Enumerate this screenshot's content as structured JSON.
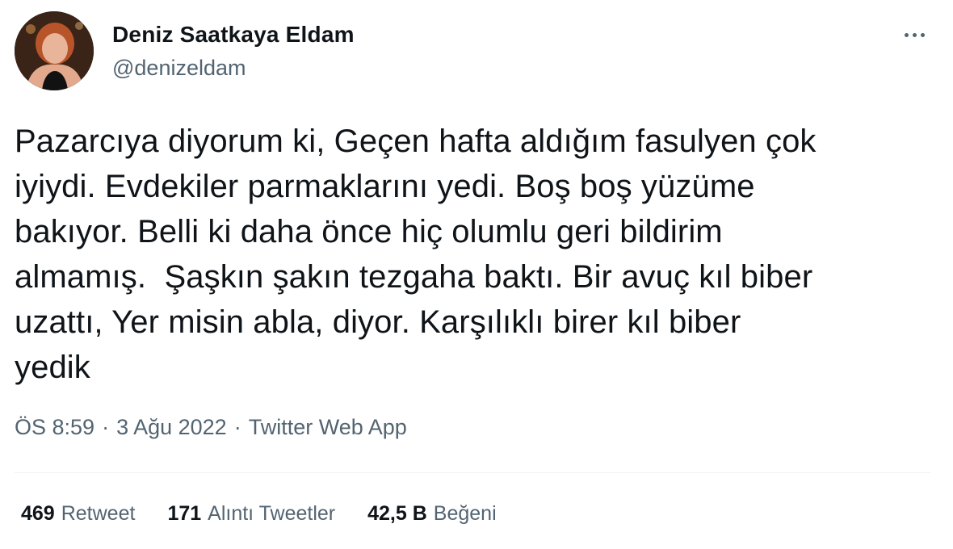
{
  "author": {
    "display_name": "Deniz Saatkaya Eldam",
    "handle": "@denizeldam"
  },
  "tweet": {
    "text": "Pazarcıya diyorum ki, Geçen hafta aldığım fasulyen çok\niyiydi. Evdekiler parmaklarını yedi. Boş boş yüzüme\nbakıyor. Belli ki daha önce hiç olumlu geri bildirim\nalmamış.  Şaşkın şakın tezgaha baktı. Bir avuç kıl biber\nuzattı, Yer misin abla, diyor. Karşılıklı birer kıl biber\nyedik"
  },
  "meta": {
    "time": "ÖS 8:59",
    "separator": "·",
    "date": "3 Ağu 2022",
    "source": "Twitter Web App"
  },
  "stats": {
    "retweets_count": "469",
    "retweets_label": "Retweet",
    "quotes_count": "171",
    "quotes_label": "Alıntı Tweetler",
    "likes_count": "42,5 B",
    "likes_label": "Beğeni"
  },
  "icons": {
    "more": "more-horizontal-icon"
  },
  "colors": {
    "text_primary": "#0f1419",
    "text_secondary": "#536471",
    "divider": "#eff3f4",
    "background": "#ffffff"
  }
}
